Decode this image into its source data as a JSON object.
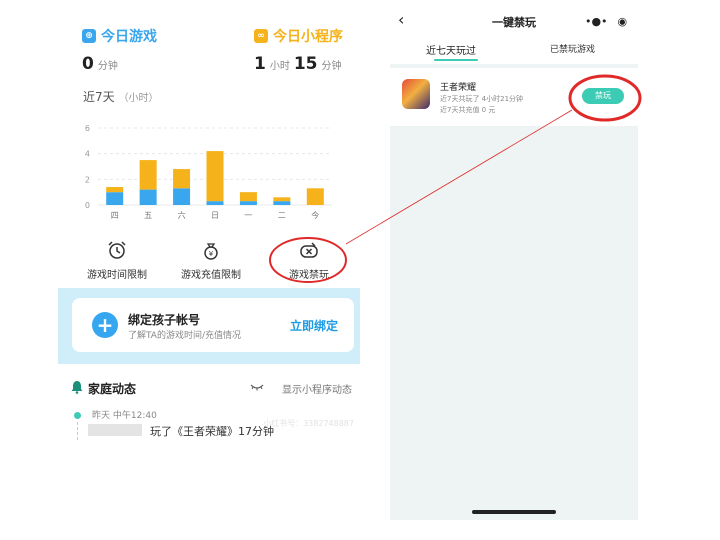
{
  "left": {
    "today_game": {
      "label": "今日游戏",
      "value": "0",
      "unit": "分钟",
      "color": "#3aa6ee"
    },
    "today_mini": {
      "label": "今日小程序",
      "hours": "1",
      "hours_unit": "小时",
      "minutes": "15",
      "minutes_unit": "分钟",
      "color": "#f5b21a"
    },
    "chart_title": "近7天",
    "chart_unit": "（小时）",
    "controls": {
      "time_limit": "游戏时间限制",
      "recharge_limit": "游戏充值限制",
      "ban": "游戏禁玩"
    },
    "bind": {
      "title": "绑定孩子帐号",
      "subtitle": "了解TA的游戏时间/充值情况",
      "action": "立即绑定"
    },
    "family": {
      "title": "家庭动态",
      "toggle": "显示小程序动态",
      "time": "昨天 中午12:40",
      "text": "玩了《王者荣耀》17分钟",
      "watermark": "小红书号：3382748887"
    }
  },
  "right": {
    "title": "一键禁玩",
    "back_glyph": "‹",
    "tabs": [
      "近七天玩过",
      "已禁玩游戏"
    ],
    "game": {
      "name": "王者荣耀",
      "line1": "近7天共玩了  4小时21分钟",
      "line2": "近7天共充值  0 元",
      "action": "禁玩"
    }
  },
  "colors": {
    "blue": "#3aa6ee",
    "orange": "#f5b21a",
    "teal": "#3ccbb4",
    "annotation": "#e02a2a"
  },
  "chart_data": {
    "type": "bar",
    "stacked": true,
    "categories": [
      "四",
      "五",
      "六",
      "日",
      "一",
      "二",
      "今"
    ],
    "series": [
      {
        "color": "#3aa6ee",
        "values": [
          1.0,
          1.2,
          1.3,
          0.3,
          0.3,
          0.3,
          0.0
        ]
      },
      {
        "color": "#f5b21a",
        "values": [
          0.4,
          2.3,
          1.5,
          3.9,
          0.7,
          0.3,
          1.3
        ]
      }
    ],
    "ylim": [
      0,
      6
    ],
    "yticks": [
      0,
      2,
      4,
      6
    ],
    "grid": true
  }
}
